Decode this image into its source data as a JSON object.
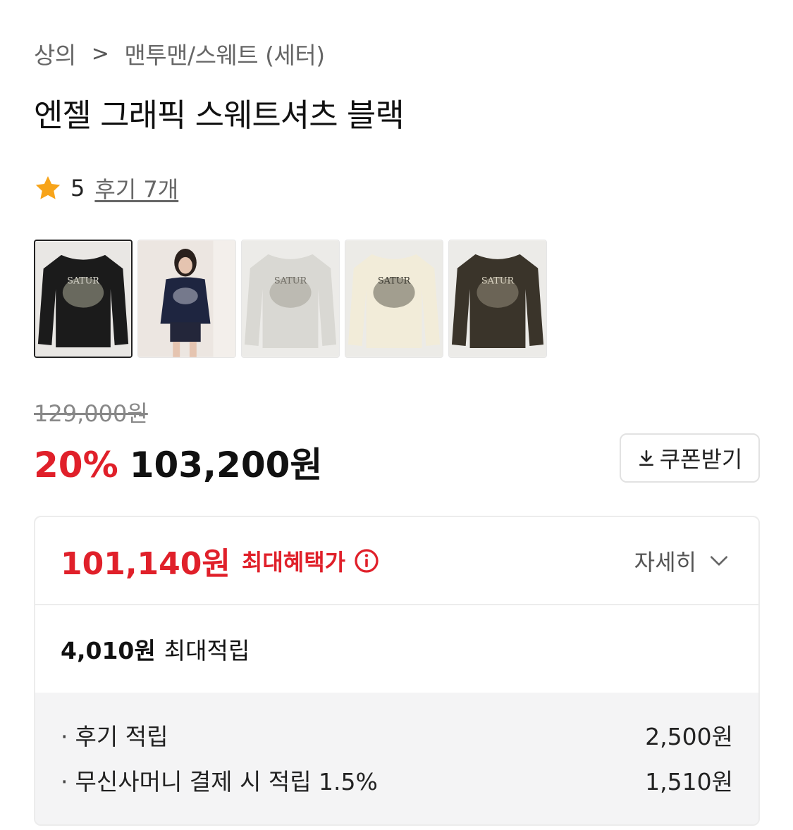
{
  "breadcrumb": {
    "category": "상의",
    "separator": ">",
    "subcategory": "맨투맨/스웨트 (세터)"
  },
  "product": {
    "title": "엔젤 그래픽 스웨트셔츠 블랙",
    "rating": "5",
    "review_link": "후기 7개",
    "thumbnails": [
      {
        "icon": "black-sweatshirt-thumbnail",
        "color": "#1b1b1b",
        "bg": "#e9e7e4"
      },
      {
        "icon": "model-photo-thumbnail",
        "color": "#1e2540",
        "bg": "#ece6e1"
      },
      {
        "icon": "gray-sweatshirt-thumbnail",
        "color": "#d9d8d3",
        "bg": "#ecebe8"
      },
      {
        "icon": "cream-sweatshirt-thumbnail",
        "color": "#f2ecd9",
        "bg": "#ecebe7"
      },
      {
        "icon": "brown-sweatshirt-thumbnail",
        "color": "#3a342a",
        "bg": "#ecebe8"
      }
    ]
  },
  "pricing": {
    "original_price": "129,000원",
    "discount_rate": "20%",
    "sale_price": "103,200원",
    "coupon_button": "쿠폰받기"
  },
  "benefit": {
    "best_price": "101,140원",
    "best_label": "최대혜택가",
    "detail_label": "자세히",
    "points_amount": "4,010원",
    "points_label": "최대적립",
    "items": [
      {
        "name": "후기 적립",
        "value": "2,500원"
      },
      {
        "name": "무신사머니 결제 시 적립 1.5%",
        "value": "1,510원"
      }
    ]
  },
  "colors": {
    "accent_red": "#e0202a",
    "star": "#f7a41a"
  }
}
